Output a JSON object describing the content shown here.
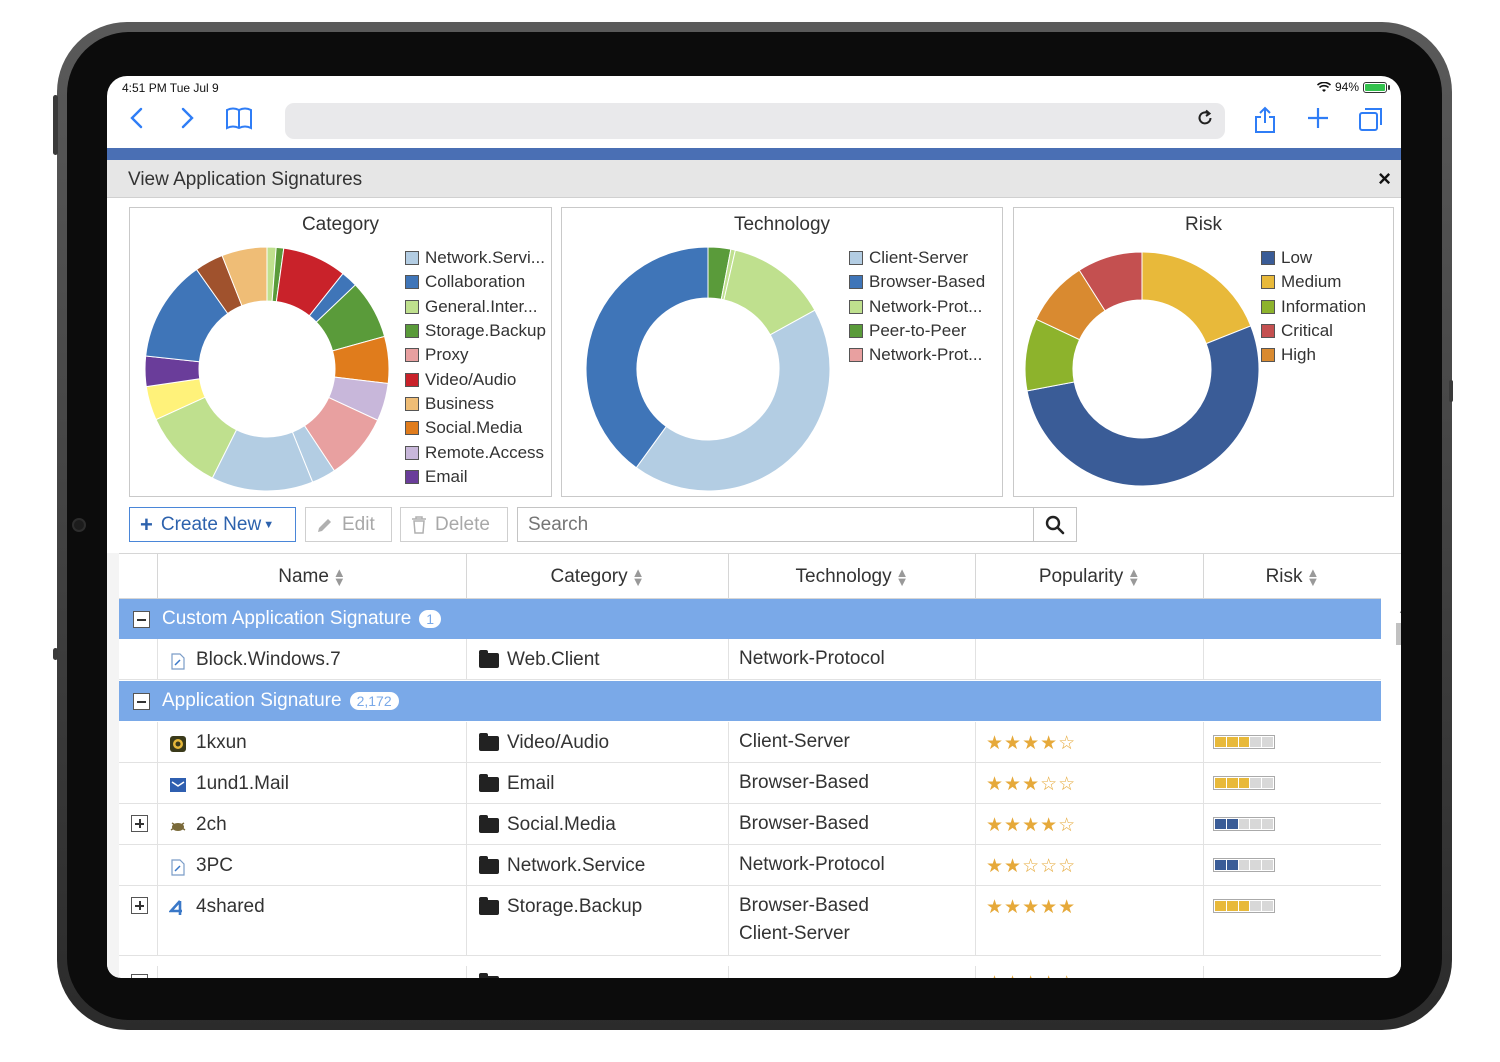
{
  "status_bar": {
    "time": "4:51 PM  Tue Jul 9",
    "battery": "94%"
  },
  "dialog": {
    "title": "View Application Signatures",
    "close": "×"
  },
  "charts": {
    "category": {
      "title": "Category"
    },
    "technology": {
      "title": "Technology"
    },
    "risk": {
      "title": "Risk"
    }
  },
  "chart_data": [
    {
      "type": "pie",
      "title": "Category",
      "legend": [
        "Network.Servi...",
        "Collaboration",
        "General.Inter...",
        "Storage.Backup",
        "Proxy",
        "Video/Audio",
        "Business",
        "Social.Media",
        "Remote.Access",
        "Email"
      ],
      "colors": [
        "#b3cde3",
        "#3f75b8",
        "#bfe08e",
        "#5a9b3a",
        "#e8a0a0",
        "#c9222a",
        "#efbd76",
        "#e07c1c",
        "#c8b7da",
        "#6a3d9a"
      ],
      "slices": [
        {
          "label": "General.Inter...",
          "value": 1.2,
          "color": "#bfe08e"
        },
        {
          "label": "Storage.Backup",
          "value": 1.0,
          "color": "#5a9b3a"
        },
        {
          "label": "Video/Audio",
          "value": 8.5,
          "color": "#c9222a"
        },
        {
          "label": "Collaboration",
          "value": 2.2,
          "color": "#3f75b8"
        },
        {
          "label": "Storage.Backup",
          "value": 7.8,
          "color": "#5a9b3a"
        },
        {
          "label": "Social.Media",
          "value": 6.2,
          "color": "#e07c1c"
        },
        {
          "label": "Remote.Access",
          "value": 5.0,
          "color": "#c8b7da"
        },
        {
          "label": "Proxy",
          "value": 8.8,
          "color": "#e8a0a0"
        },
        {
          "label": "Collaboration",
          "value": 3.2,
          "color": "#b3cde3"
        },
        {
          "label": "Network.Servi...",
          "value": 13.5,
          "color": "#b3cde3"
        },
        {
          "label": "General.Inter...",
          "value": 10.8,
          "color": "#bfe08e"
        },
        {
          "label": "Business",
          "value": 4.5,
          "color": "#fff27a"
        },
        {
          "label": "Email",
          "value": 4.0,
          "color": "#6a3d9a"
        },
        {
          "label": "Collaboration",
          "value": 13.5,
          "color": "#3f75b8"
        },
        {
          "label": "Social.Media",
          "value": 3.8,
          "color": "#a0522d"
        },
        {
          "label": "Business",
          "value": 6.0,
          "color": "#efbd76"
        }
      ]
    },
    {
      "type": "pie",
      "title": "Technology",
      "legend": [
        "Client-Server",
        "Browser-Based",
        "Network-Prot...",
        "Peer-to-Peer",
        "Network-Prot..."
      ],
      "colors": [
        "#b3cde3",
        "#3f75b8",
        "#bfe08e",
        "#5a9b3a",
        "#e8a0a0"
      ],
      "slices": [
        {
          "label": "Peer-to-Peer",
          "value": 3.0,
          "color": "#5a9b3a"
        },
        {
          "label": "Network-Prot...",
          "value": 0.6,
          "color": "#bfe08e"
        },
        {
          "label": "Network-Prot...",
          "value": 13.4,
          "color": "#bfe08e"
        },
        {
          "label": "Client-Server",
          "value": 43.0,
          "color": "#b3cde3"
        },
        {
          "label": "Browser-Based",
          "value": 40.0,
          "color": "#3f75b8"
        }
      ]
    },
    {
      "type": "pie",
      "title": "Risk",
      "legend": [
        "Low",
        "Medium",
        "Information",
        "Critical",
        "High"
      ],
      "colors": [
        "#3a5c97",
        "#e8b93a",
        "#8db32c",
        "#c45050",
        "#d98a30"
      ],
      "slices": [
        {
          "label": "Medium",
          "value": 19.0,
          "color": "#e8b93a"
        },
        {
          "label": "Low",
          "value": 53.0,
          "color": "#3a5c97"
        },
        {
          "label": "Information",
          "value": 10.0,
          "color": "#8db32c"
        },
        {
          "label": "High",
          "value": 9.0,
          "color": "#d98a30"
        },
        {
          "label": "Critical",
          "value": 9.0,
          "color": "#c45050"
        }
      ]
    }
  ],
  "actions": {
    "create_new": "Create New",
    "edit": "Edit",
    "delete": "Delete",
    "search_placeholder": "Search"
  },
  "table": {
    "columns": [
      "Name",
      "Category",
      "Technology",
      "Popularity",
      "Risk"
    ],
    "groups": [
      {
        "label": "Custom Application Signature",
        "count": "1"
      },
      {
        "label": "Application Signature",
        "count": "2,172"
      }
    ],
    "custom_rows": [
      {
        "name": "Block.Windows.7",
        "category": "Web.Client",
        "technology": "Network-Protocol",
        "icon": "document-icon"
      }
    ],
    "rows": [
      {
        "name": "1kxun",
        "category": "Video/Audio",
        "technology": "Client-Server",
        "stars": "★★★★☆",
        "risk_level": 3,
        "risk_color": "#e8b93a",
        "expandable": false,
        "icon": "1kxun-icon"
      },
      {
        "name": "1und1.Mail",
        "category": "Email",
        "technology": "Browser-Based",
        "stars": "★★★☆☆",
        "risk_level": 3,
        "risk_color": "#e8b93a",
        "expandable": false,
        "icon": "mail-icon"
      },
      {
        "name": "2ch",
        "category": "Social.Media",
        "technology": "Browser-Based",
        "stars": "★★★★☆",
        "risk_level": 2,
        "risk_color": "#3a5c97",
        "expandable": true,
        "icon": "2ch-icon"
      },
      {
        "name": "3PC",
        "category": "Network.Service",
        "technology": "Network-Protocol",
        "stars": "★★☆☆☆",
        "risk_level": 2,
        "risk_color": "#3a5c97",
        "expandable": false,
        "icon": "document-icon"
      },
      {
        "name": "4shared",
        "category": "Storage.Backup",
        "technology_lines": [
          "Browser-Based",
          "Client-Server"
        ],
        "stars": "★★★★★",
        "risk_level": 3,
        "risk_color": "#e8b93a",
        "expandable": true,
        "icon": "4shared-icon"
      }
    ]
  }
}
